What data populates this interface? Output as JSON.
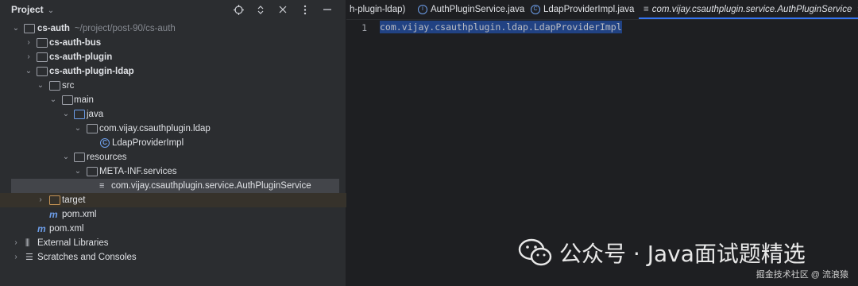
{
  "project_panel": {
    "title": "Project",
    "header_icons": [
      "target-icon",
      "expand-collapse-icon",
      "close-icon",
      "more-icon",
      "minimize-icon"
    ],
    "tree": [
      {
        "label": "cs-auth",
        "path": "~/project/post-90/cs-auth",
        "bold": true,
        "depth": 0,
        "arrow": "down",
        "icon": "module-folder-icon"
      },
      {
        "label": "cs-auth-bus",
        "bold": true,
        "depth": 1,
        "arrow": "right",
        "icon": "module-folder-icon"
      },
      {
        "label": "cs-auth-plugin",
        "bold": true,
        "depth": 1,
        "arrow": "right",
        "icon": "module-folder-icon"
      },
      {
        "label": "cs-auth-plugin-ldap",
        "bold": true,
        "depth": 1,
        "arrow": "down",
        "icon": "module-folder-icon"
      },
      {
        "label": "src",
        "depth": 2,
        "arrow": "down",
        "icon": "folder-icon"
      },
      {
        "label": "main",
        "depth": 3,
        "arrow": "down",
        "icon": "folder-icon"
      },
      {
        "label": "java",
        "depth": 4,
        "arrow": "down",
        "icon": "source-folder-icon"
      },
      {
        "label": "com.vijay.csauthplugin.ldap",
        "depth": 5,
        "arrow": "down",
        "icon": "package-icon"
      },
      {
        "label": "LdapProviderImpl",
        "depth": 6,
        "arrow": "",
        "icon": "class-icon"
      },
      {
        "label": "resources",
        "depth": 4,
        "arrow": "down",
        "icon": "resources-folder-icon"
      },
      {
        "label": "META-INF.services",
        "depth": 5,
        "arrow": "down",
        "icon": "folder-icon"
      },
      {
        "label": "com.vijay.csauthplugin.service.AuthPluginService",
        "depth": 6,
        "arrow": "",
        "icon": "text-file-icon",
        "selected": true
      },
      {
        "label": "target",
        "depth": 2,
        "arrow": "right",
        "icon": "excluded-folder-icon",
        "highlight": true
      },
      {
        "label": "pom.xml",
        "depth": 2,
        "arrow": "",
        "icon": "maven-icon"
      },
      {
        "label": "pom.xml",
        "depth": 1,
        "arrow": "",
        "icon": "maven-icon"
      },
      {
        "label": "External Libraries",
        "depth": 0,
        "arrow": "right",
        "icon": "library-icon"
      },
      {
        "label": "Scratches and Consoles",
        "depth": 0,
        "arrow": "right",
        "icon": "scratches-icon"
      }
    ]
  },
  "editor": {
    "tabs": [
      {
        "label": "h-plugin-ldap)",
        "icon": ""
      },
      {
        "label": "AuthPluginService.java",
        "icon": "interface-icon"
      },
      {
        "label": "LdapProviderImpl.java",
        "icon": "class-icon"
      },
      {
        "label": "com.vijay.csauthplugin.service.AuthPluginService",
        "icon": "text-file-icon",
        "active": true
      }
    ],
    "line_number": "1",
    "code_line": "com.vijay.csauthplugin.ldap.LdapProviderImpl"
  },
  "watermark": {
    "text": "公众号 · Java面试题精选",
    "credit": "掘金技术社区 @ 流浪猿"
  }
}
